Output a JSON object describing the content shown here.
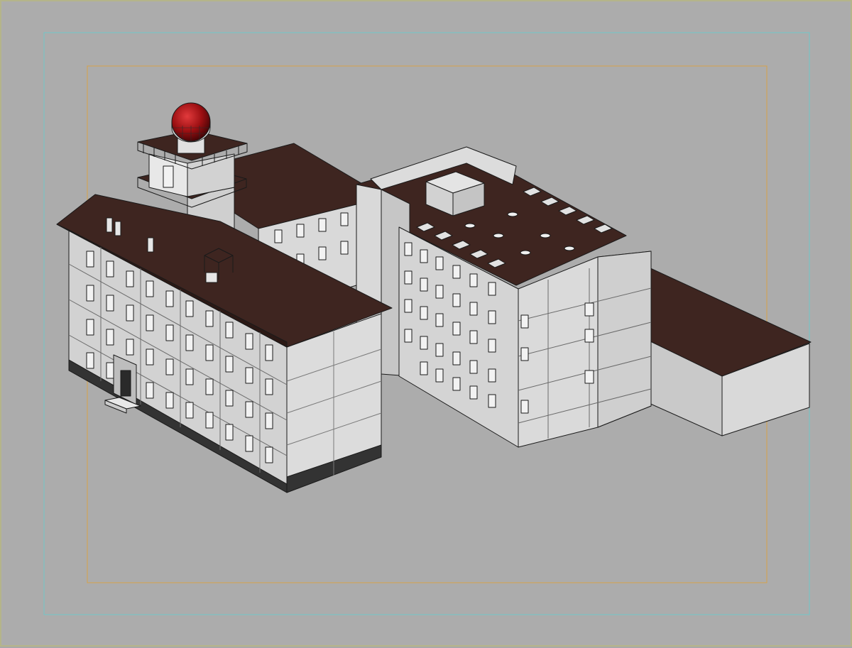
{
  "viewport": {
    "background": "#acacac",
    "border_color": "#b5b58a",
    "safe_frame_outer_color": "#6fc6c9",
    "safe_frame_inner_color": "#d6a24a"
  },
  "model": {
    "roof_color": "#3e2520",
    "wall_color": "#d9d9d9",
    "wall_shade_color": "#c4c4c4",
    "plinth_color": "#333333",
    "window_color": "#f2f2f2",
    "dome_color": "#9b0f12",
    "outline_color": "#1a1a1a"
  }
}
